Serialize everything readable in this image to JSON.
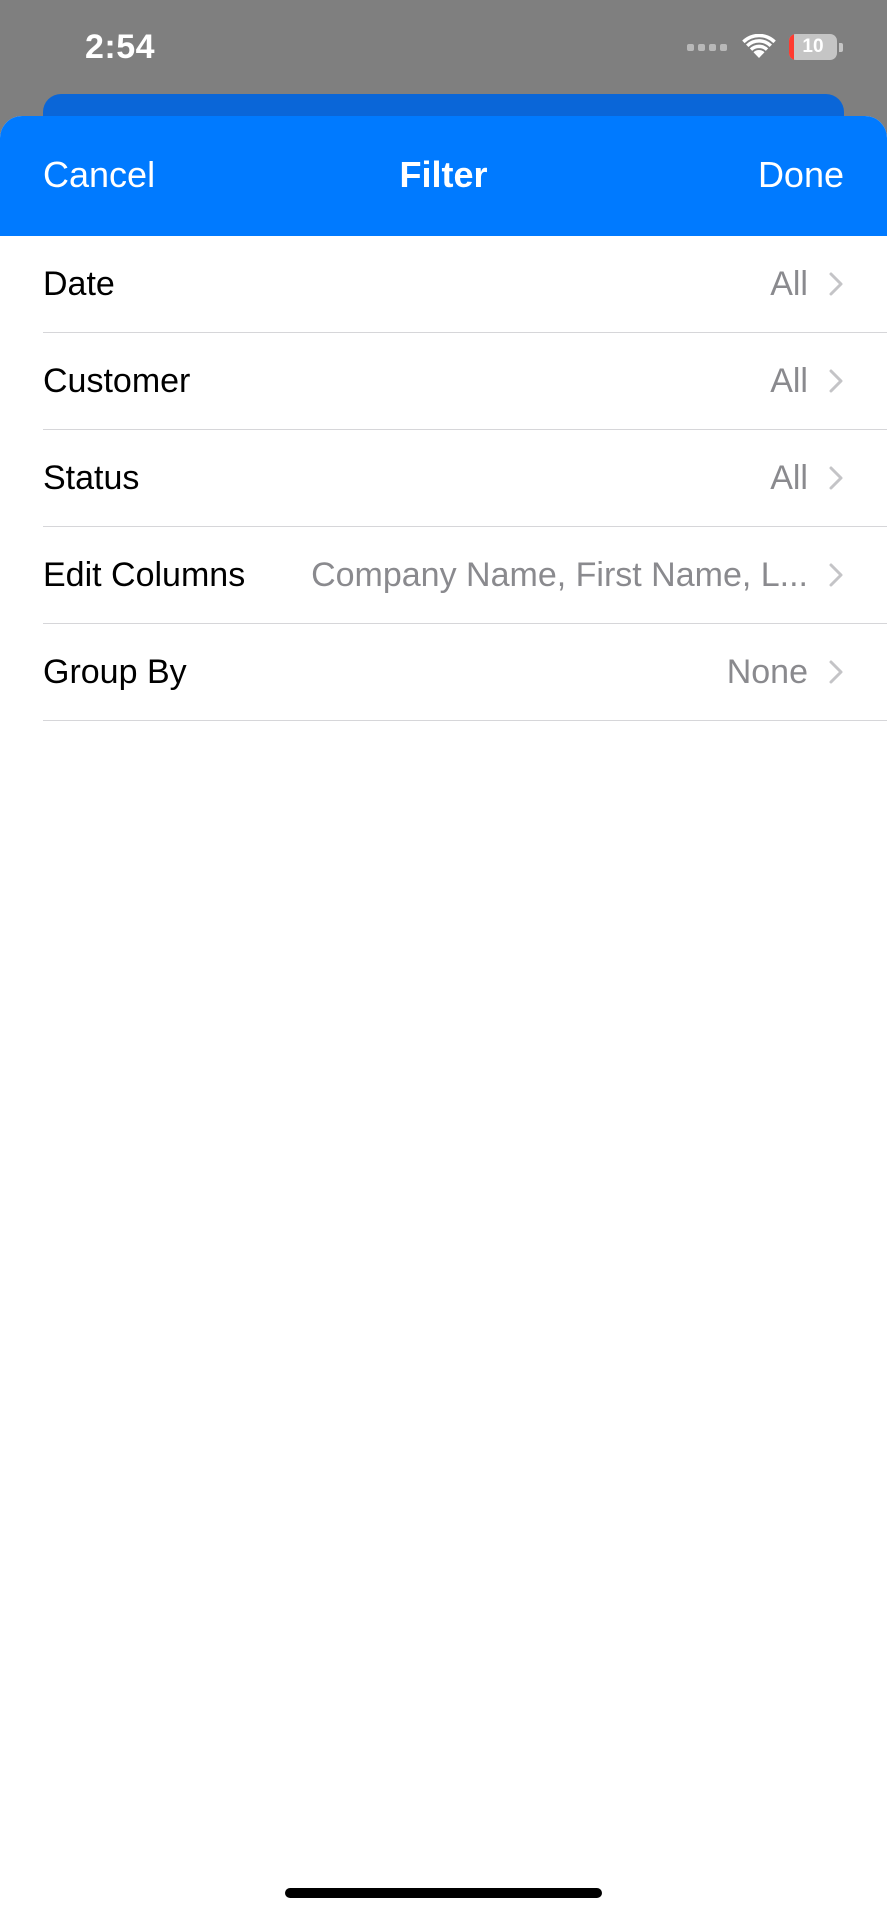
{
  "status_bar": {
    "time": "2:54",
    "battery": "10",
    "signal_icon": "cellular-dots-icon",
    "wifi_icon": "wifi-icon",
    "battery_icon": "battery-charging-icon"
  },
  "nav": {
    "cancel_label": "Cancel",
    "title": "Filter",
    "done_label": "Done",
    "bar_color": "#007aff"
  },
  "rows": [
    {
      "label": "Date",
      "value": "All"
    },
    {
      "label": "Customer",
      "value": "All"
    },
    {
      "label": "Status",
      "value": "All"
    },
    {
      "label": "Edit Columns",
      "value": "Company Name, First Name, L..."
    },
    {
      "label": "Group By",
      "value": "None"
    }
  ],
  "colors": {
    "accent": "#007aff",
    "secondary_text": "#8a8a8e",
    "separator": "#d6d6d9"
  }
}
